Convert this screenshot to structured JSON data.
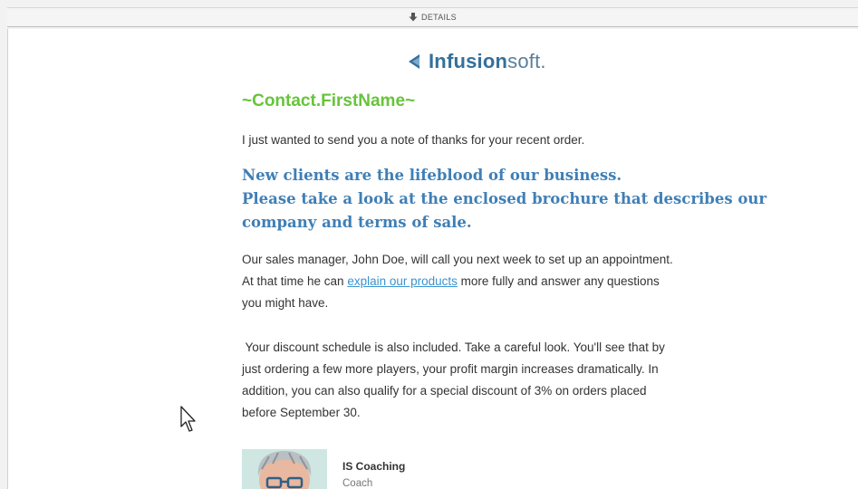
{
  "details_bar": {
    "label": "DETAILS",
    "icon": "download-arrow-icon"
  },
  "logo": {
    "bold": "Infusion",
    "thin": "soft.",
    "color": "#34709b"
  },
  "email": {
    "merge_field": "~Contact.FirstName~",
    "intro": "I just wanted to send you a note of thanks for your recent order.",
    "headline": [
      "New clients are the lifeblood of our business.",
      "Please take a look at the enclosed brochure that describes our",
      "company and terms of sale."
    ],
    "paragraph2": {
      "line1": "Our sales manager, John Doe, will call you next week to set up an appointment.",
      "line2_before": "At that time he can ",
      "link": "explain our products",
      "line2_after": " more fully and answer any questions",
      "line3": "you might have."
    },
    "paragraph3": [
      " Your discount schedule is also included. Take a careful look. You'll see that by",
      "just ordering a few more players, your profit margin increases dramatically. In",
      "addition, you can also qualify for a special discount of 3% on orders placed",
      "before September 30."
    ],
    "signature": {
      "name": "IS Coaching",
      "title": "Coach"
    }
  },
  "colors": {
    "merge_field": "#66c43a",
    "headline": "#3f7fb6",
    "link": "#3a92cf"
  }
}
